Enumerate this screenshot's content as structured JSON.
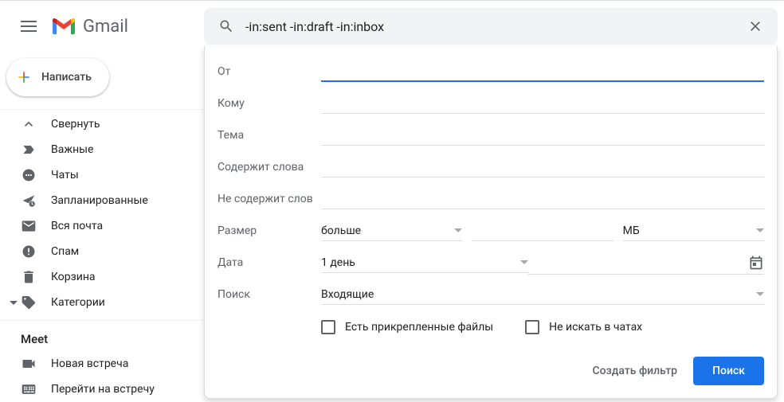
{
  "header": {
    "product_name": "Gmail",
    "search_value": "-in:sent -in:draft -in:inbox"
  },
  "compose": {
    "label": "Написать"
  },
  "sidebar": {
    "items": [
      {
        "label": "Свернуть",
        "icon": "chevron-up-icon"
      },
      {
        "label": "Важные",
        "icon": "important-icon"
      },
      {
        "label": "Чаты",
        "icon": "chats-icon"
      },
      {
        "label": "Запланированные",
        "icon": "scheduled-icon"
      },
      {
        "label": "Вся почта",
        "icon": "all-mail-icon"
      },
      {
        "label": "Спам",
        "icon": "spam-icon"
      },
      {
        "label": "Корзина",
        "icon": "trash-icon"
      },
      {
        "label": "Категории",
        "icon": "categories-icon",
        "expandable": true
      }
    ]
  },
  "meet": {
    "header": "Meet",
    "items": [
      {
        "label": "Новая встреча",
        "icon": "videocam-icon"
      },
      {
        "label": "Перейти на встречу",
        "icon": "keyboard-icon"
      }
    ]
  },
  "search_panel": {
    "from_label": "От",
    "to_label": "Кому",
    "subject_label": "Тема",
    "has_words_label": "Содержит слова",
    "not_words_label": "Не содержит слов",
    "size_label": "Размер",
    "size_operator": "больше",
    "size_unit": "МБ",
    "date_label": "Дата",
    "date_value": "1 день",
    "search_in_label": "Поиск",
    "search_in_value": "Входящие",
    "has_attachment": "Есть прикрепленные файлы",
    "exclude_chats": "Не искать в чатах",
    "create_filter": "Создать фильтр",
    "search_button": "Поиск"
  }
}
